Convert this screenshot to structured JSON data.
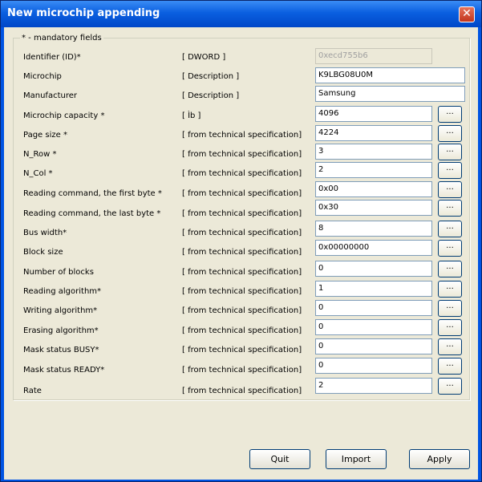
{
  "window": {
    "title": "New microchip appending",
    "close_label": "✕"
  },
  "group": {
    "legend": "* - mandatory fields"
  },
  "fields": [
    {
      "label": "Identifier (ID)*",
      "hint": "[ DWORD ]",
      "value": "0xecd755b6"
    },
    {
      "label": "Microchip",
      "hint": "[ Description ]",
      "value": "K9LBG08U0M"
    },
    {
      "label": "Manufacturer",
      "hint": "[ Description ]",
      "value": "Samsung"
    },
    {
      "label": "Microchip capacity *",
      "hint": "[ Ìb ]",
      "value": "4096"
    },
    {
      "label": "Page size *",
      "hint": "[ from technical specification]",
      "value": "4224"
    },
    {
      "label": "N_Row *",
      "hint": "[ from technical specification]",
      "value": "3"
    },
    {
      "label": "N_Col *",
      "hint": "[ from technical specification]",
      "value": "2"
    },
    {
      "label": "Reading command, the first byte *",
      "hint": "[ from technical specification]",
      "value": "0x00"
    },
    {
      "label": "Reading command, the last byte *",
      "hint": "[ from technical specification]",
      "value": "0x30"
    },
    {
      "label": "Bus width*",
      "hint": "[ from technical specification]",
      "value": "8"
    },
    {
      "label": "Block size",
      "hint": "[ from technical specification]",
      "value": "0x00000000"
    },
    {
      "label": "Number of blocks",
      "hint": "[ from technical specification]",
      "value": "0"
    },
    {
      "label": "Reading algorithm*",
      "hint": "[ from technical specification]",
      "value": "1"
    },
    {
      "label": "Writing algorithm*",
      "hint": "[ from technical specification]",
      "value": "0"
    },
    {
      "label": "Erasing algorithm*",
      "hint": "[ from technical specification]",
      "value": "0"
    },
    {
      "label": "Mask status BUSY*",
      "hint": "[ from technical specification]",
      "value": "0"
    },
    {
      "label": "Mask status READY*",
      "hint": "[ from technical specification]",
      "value": "0"
    },
    {
      "label": "Rate",
      "hint": "[ from technical specification]",
      "value": "2"
    }
  ],
  "more_label": "...",
  "buttons": {
    "quit": "Quit",
    "import": "Import",
    "apply": "Apply"
  }
}
